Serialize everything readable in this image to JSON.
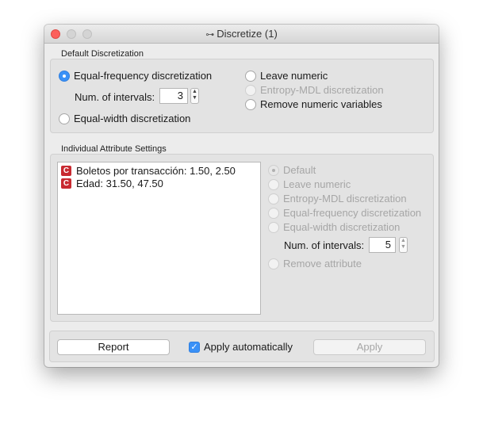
{
  "window": {
    "title": "Discretize (1)",
    "app_icon": "orange-widget-icon"
  },
  "default_discretization": {
    "label": "Default Discretization",
    "options": [
      {
        "label": "Equal-frequency discretization",
        "checked": true,
        "enabled": true
      },
      {
        "label": "Equal-width discretization",
        "checked": false,
        "enabled": true
      },
      {
        "label": "Leave numeric",
        "checked": false,
        "enabled": true
      },
      {
        "label": "Entropy-MDL discretization",
        "checked": false,
        "enabled": false
      },
      {
        "label": "Remove numeric variables",
        "checked": false,
        "enabled": true
      }
    ],
    "intervals_label": "Num. of intervals:",
    "intervals_value": "3"
  },
  "individual_settings": {
    "label": "Individual Attribute Settings",
    "attributes": [
      {
        "type_badge": "C",
        "text": "Boletos por transacción: 1.50, 2.50"
      },
      {
        "type_badge": "C",
        "text": "Edad: 31.50, 47.50"
      }
    ],
    "options": [
      {
        "label": "Default",
        "checked": true,
        "enabled": false
      },
      {
        "label": "Leave numeric",
        "checked": false,
        "enabled": false
      },
      {
        "label": "Entropy-MDL discretization",
        "checked": false,
        "enabled": false
      },
      {
        "label": "Equal-frequency discretization",
        "checked": false,
        "enabled": false
      },
      {
        "label": "Equal-width discretization",
        "checked": false,
        "enabled": false
      },
      {
        "label": "Remove attribute",
        "checked": false,
        "enabled": false
      }
    ],
    "intervals_label": "Num. of intervals:",
    "intervals_value": "5"
  },
  "footer": {
    "report_label": "Report",
    "apply_auto_label": "Apply automatically",
    "apply_auto_checked": true,
    "apply_label": "Apply"
  },
  "colors": {
    "accent": "#3a91f7",
    "close_button": "#fc605c",
    "continuous_badge": "#c82a31"
  }
}
